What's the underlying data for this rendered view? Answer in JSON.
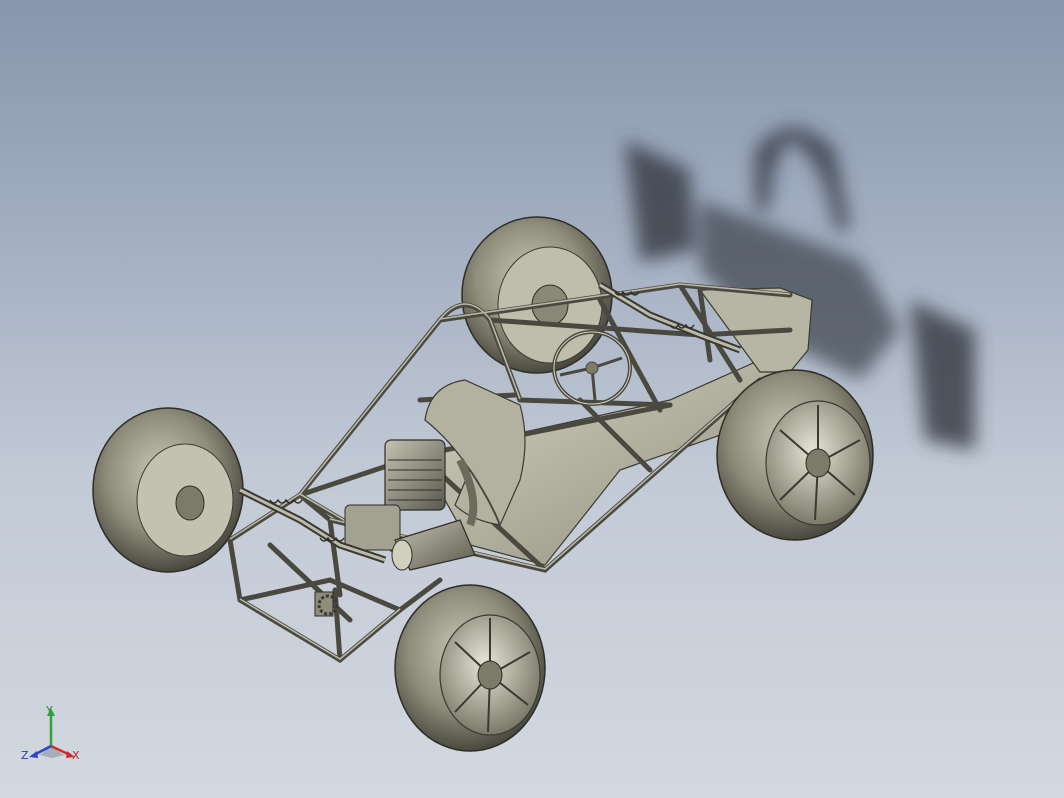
{
  "triad": {
    "x_label": "X",
    "y_label": "Y",
    "z_label": "Z",
    "x_color": "#d12a2a",
    "y_color": "#2fa23a",
    "z_color": "#2c46c9"
  },
  "scene": {
    "model_color": "#9c9a86",
    "shadow_color": "#3a3f48"
  }
}
